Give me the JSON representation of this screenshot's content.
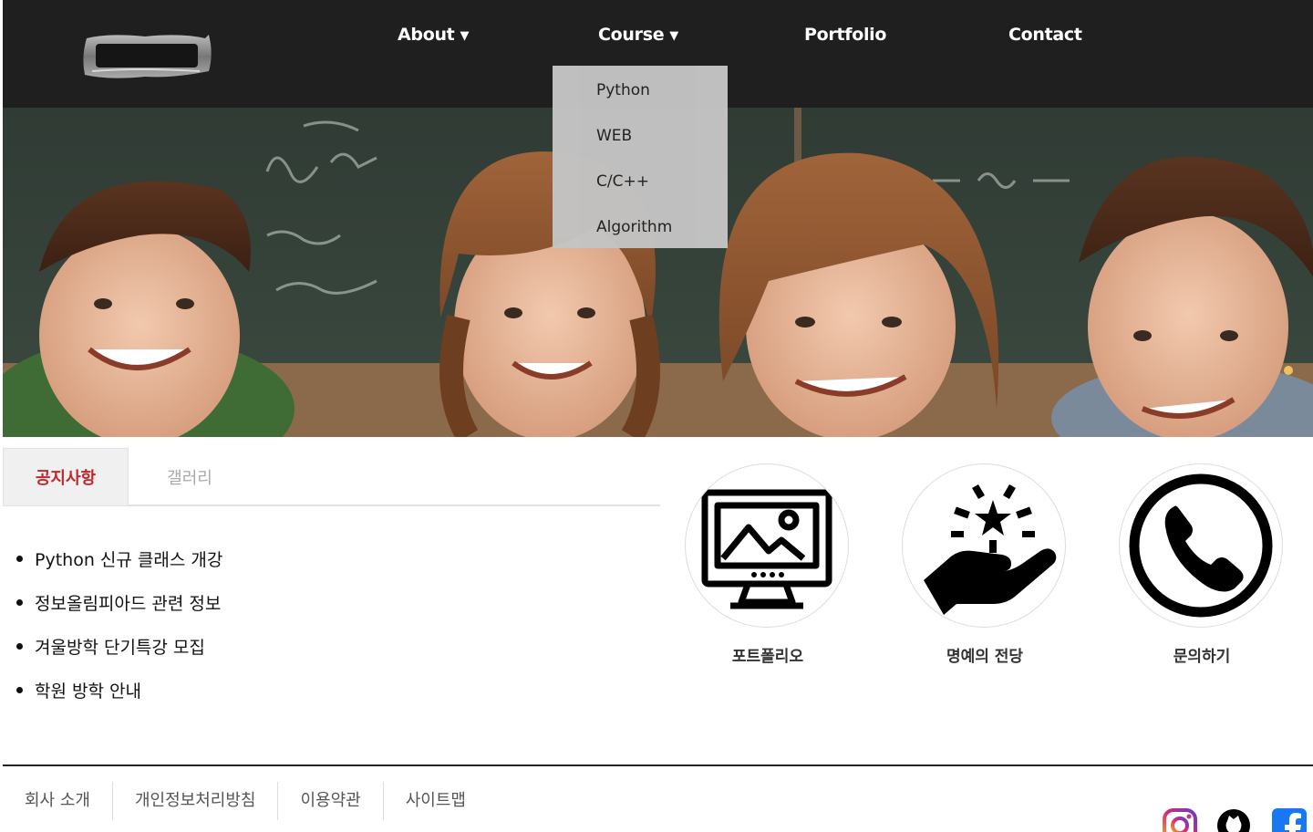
{
  "nav": {
    "about": "About",
    "course": "Course",
    "portfolio": "Portfolio",
    "contact": "Contact",
    "caret": "▼"
  },
  "course_menu": {
    "items": [
      "Python",
      "WEB",
      "C/C++",
      "Algorithm"
    ]
  },
  "tabs": {
    "active": "공지사항",
    "inactive": "갤러리"
  },
  "notices": [
    "Python 신규 클래스 개강",
    "정보올림피아드 관련 정보",
    "겨울방학 단기특강 모집",
    "학원 방학 안내"
  ],
  "quick_links": {
    "portfolio": {
      "label": "포트폴리오",
      "icon": "monitor-gallery-icon"
    },
    "honor": {
      "label": "명예의 전당",
      "icon": "hand-star-icon"
    },
    "inquiry": {
      "label": "문의하기",
      "icon": "phone-icon"
    }
  },
  "footer": {
    "links": [
      "회사 소개",
      "개인정보처리방침",
      "이용약관",
      "사이트맵"
    ]
  },
  "social": {
    "instagram": "instagram-icon",
    "github": "github-icon",
    "facebook": "facebook-icon"
  },
  "colors": {
    "header_bg": "#1f1f1f",
    "dropdown_bg": "#c4c4c4",
    "active_tab_text": "#c0282d",
    "facebook_blue": "#1877f2"
  }
}
